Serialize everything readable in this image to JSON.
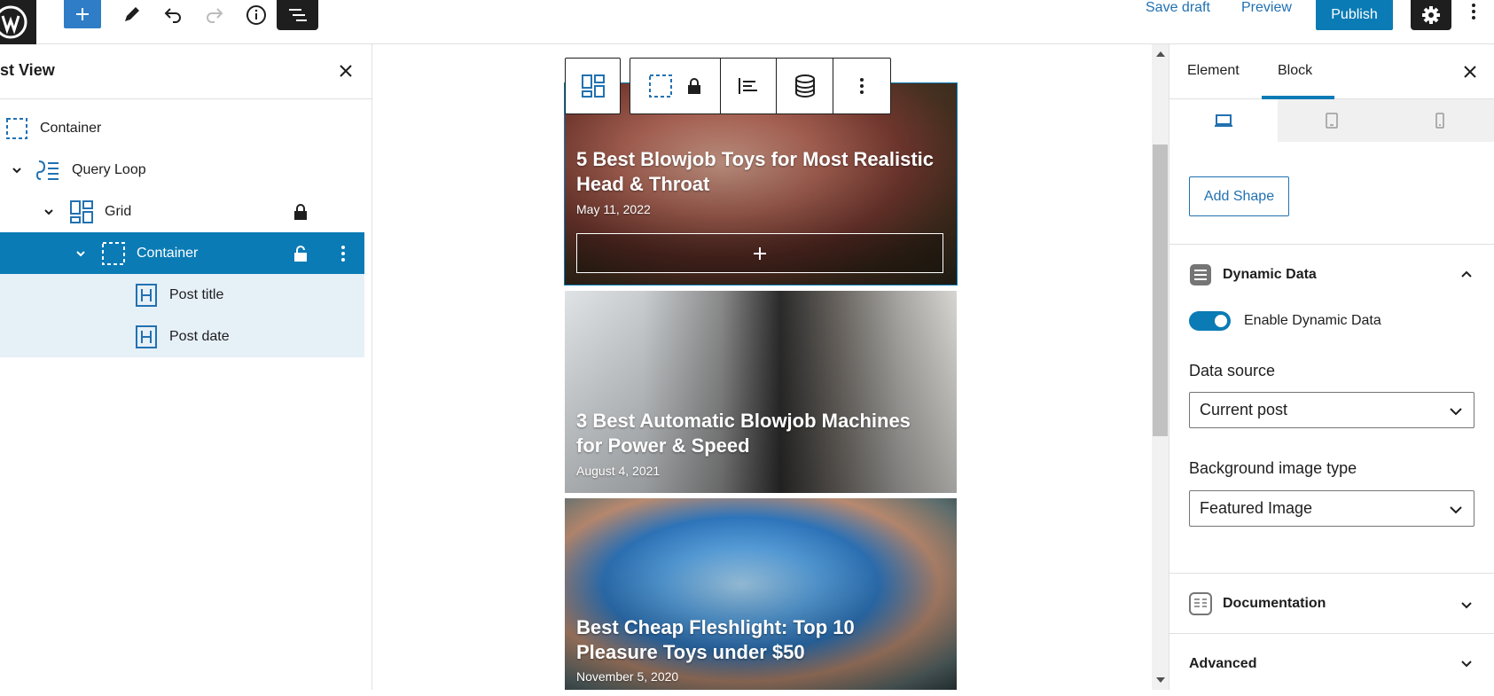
{
  "topbar": {
    "save_draft": "Save draft",
    "preview": "Preview",
    "publish": "Publish"
  },
  "list_view": {
    "title": "st View",
    "rows": [
      {
        "label": "Container"
      },
      {
        "label": "Query Loop"
      },
      {
        "label": "Grid"
      },
      {
        "label": "Container"
      },
      {
        "label": "Post title"
      },
      {
        "label": "Post date"
      }
    ]
  },
  "posts": [
    {
      "title": "5 Best Blowjob Toys for Most Realistic Head & Throat",
      "date": "May 11, 2022"
    },
    {
      "title": "3 Best Automatic Blowjob Machines for Power & Speed",
      "date": "August 4, 2021"
    },
    {
      "title": "Best Cheap Fleshlight: Top 10 Pleasure Toys under $50",
      "date": "November 5, 2020"
    }
  ],
  "settings": {
    "tabs": [
      "Element",
      "Block"
    ],
    "active_tab": "Block",
    "add_shape": "Add Shape",
    "dynamic_data": {
      "title": "Dynamic Data",
      "toggle_label": "Enable Dynamic Data",
      "toggle_on": true,
      "data_source_label": "Data source",
      "data_source_value": "Current post",
      "bg_type_label": "Background image type",
      "bg_type_value": "Featured Image"
    },
    "documentation": "Documentation",
    "advanced": "Advanced"
  },
  "colors": {
    "accent": "#0a7bb5",
    "dark": "#1e1e1e",
    "selected_child_bg": "#e6f0f7"
  }
}
